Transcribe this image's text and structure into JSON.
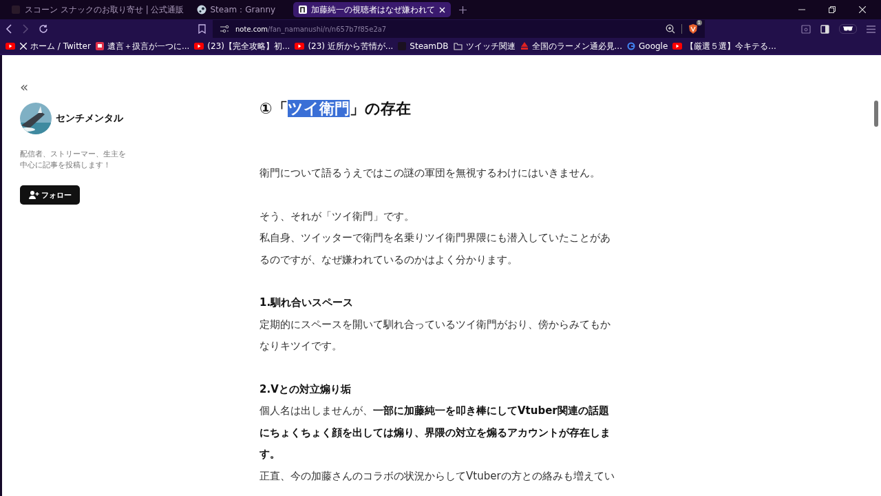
{
  "tabs": [
    {
      "title": "スコーン スナックのお取り寄せ | 公式通販",
      "kind": "dark",
      "selected": false
    },
    {
      "title": "Steam：Granny",
      "kind": "steam",
      "selected": false
    },
    {
      "title": "加藤純一の視聴者はなぜ嫌われて",
      "kind": "note",
      "selected": true
    }
  ],
  "address": {
    "host": "note.com",
    "path": "/fan_namanushi/n/n657b7f85e2a7"
  },
  "shield_count": "1",
  "bookmarks": [
    {
      "kind": "youtube"
    },
    {
      "label": "ホーム / Twitter",
      "kind": "x"
    },
    {
      "label": "遺言＋扱言が一つに...",
      "kind": "app"
    },
    {
      "label": "(23)【完全攻略】初...",
      "kind": "youtube"
    },
    {
      "label": "(23) 近所から苦情が...",
      "kind": "youtube"
    },
    {
      "label": "SteamDB",
      "kind": "dark"
    },
    {
      "label": "ツイッチ関連",
      "kind": "folder"
    },
    {
      "label": "全国のラーメン通必見...",
      "kind": "ramen"
    },
    {
      "label": "Google",
      "kind": "google"
    },
    {
      "label": "【厳選５選】今キテる...",
      "kind": "youtube"
    }
  ],
  "sidebar": {
    "collapse": "«",
    "author": "センチメンタル",
    "bio": "配信者、ストリーマー、生主を中心に記事を投稿します！",
    "follow_button": "フォロー"
  },
  "article": {
    "heading": {
      "before": "①「",
      "highlighted": "ツイ衛門",
      "after": "」の存在"
    },
    "blocks": [
      {
        "kind": "gap"
      },
      {
        "kind": "text",
        "text": "衛門について語るうえではこの謎の軍団を無視するわけにはいきません。"
      },
      {
        "kind": "gap"
      },
      {
        "kind": "text",
        "text": "そう、それが「ツイ衛門」です。"
      },
      {
        "kind": "text",
        "text": "私自身、ツイッターで衛門を名乗りツイ衛門界隈にも潜入していたことがあるのですが、なぜ嫌われているのかはよく分かります。"
      },
      {
        "kind": "gap"
      },
      {
        "kind": "subheading",
        "text": "1.馴れ合いスペース"
      },
      {
        "kind": "text",
        "text": "定期的にスペースを開いて馴れ合っているツイ衛門がおり、傍からみてもかなりキツイです。"
      },
      {
        "kind": "gap"
      },
      {
        "kind": "subheading",
        "text": "2.Vとの対立煽り垢"
      },
      {
        "kind": "text",
        "text": "個人名は出しませんが、**一部に加藤純一を叩き棒にしてVtuber関連の話題にちょくちょく顔を出しては煽り、界隈の対立を煽るアカウントが存在します。**"
      },
      {
        "kind": "text",
        "text": "正直、今の加藤さんのコラボの状況からしてVtuberの方との絡みも増えてい"
      }
    ]
  }
}
